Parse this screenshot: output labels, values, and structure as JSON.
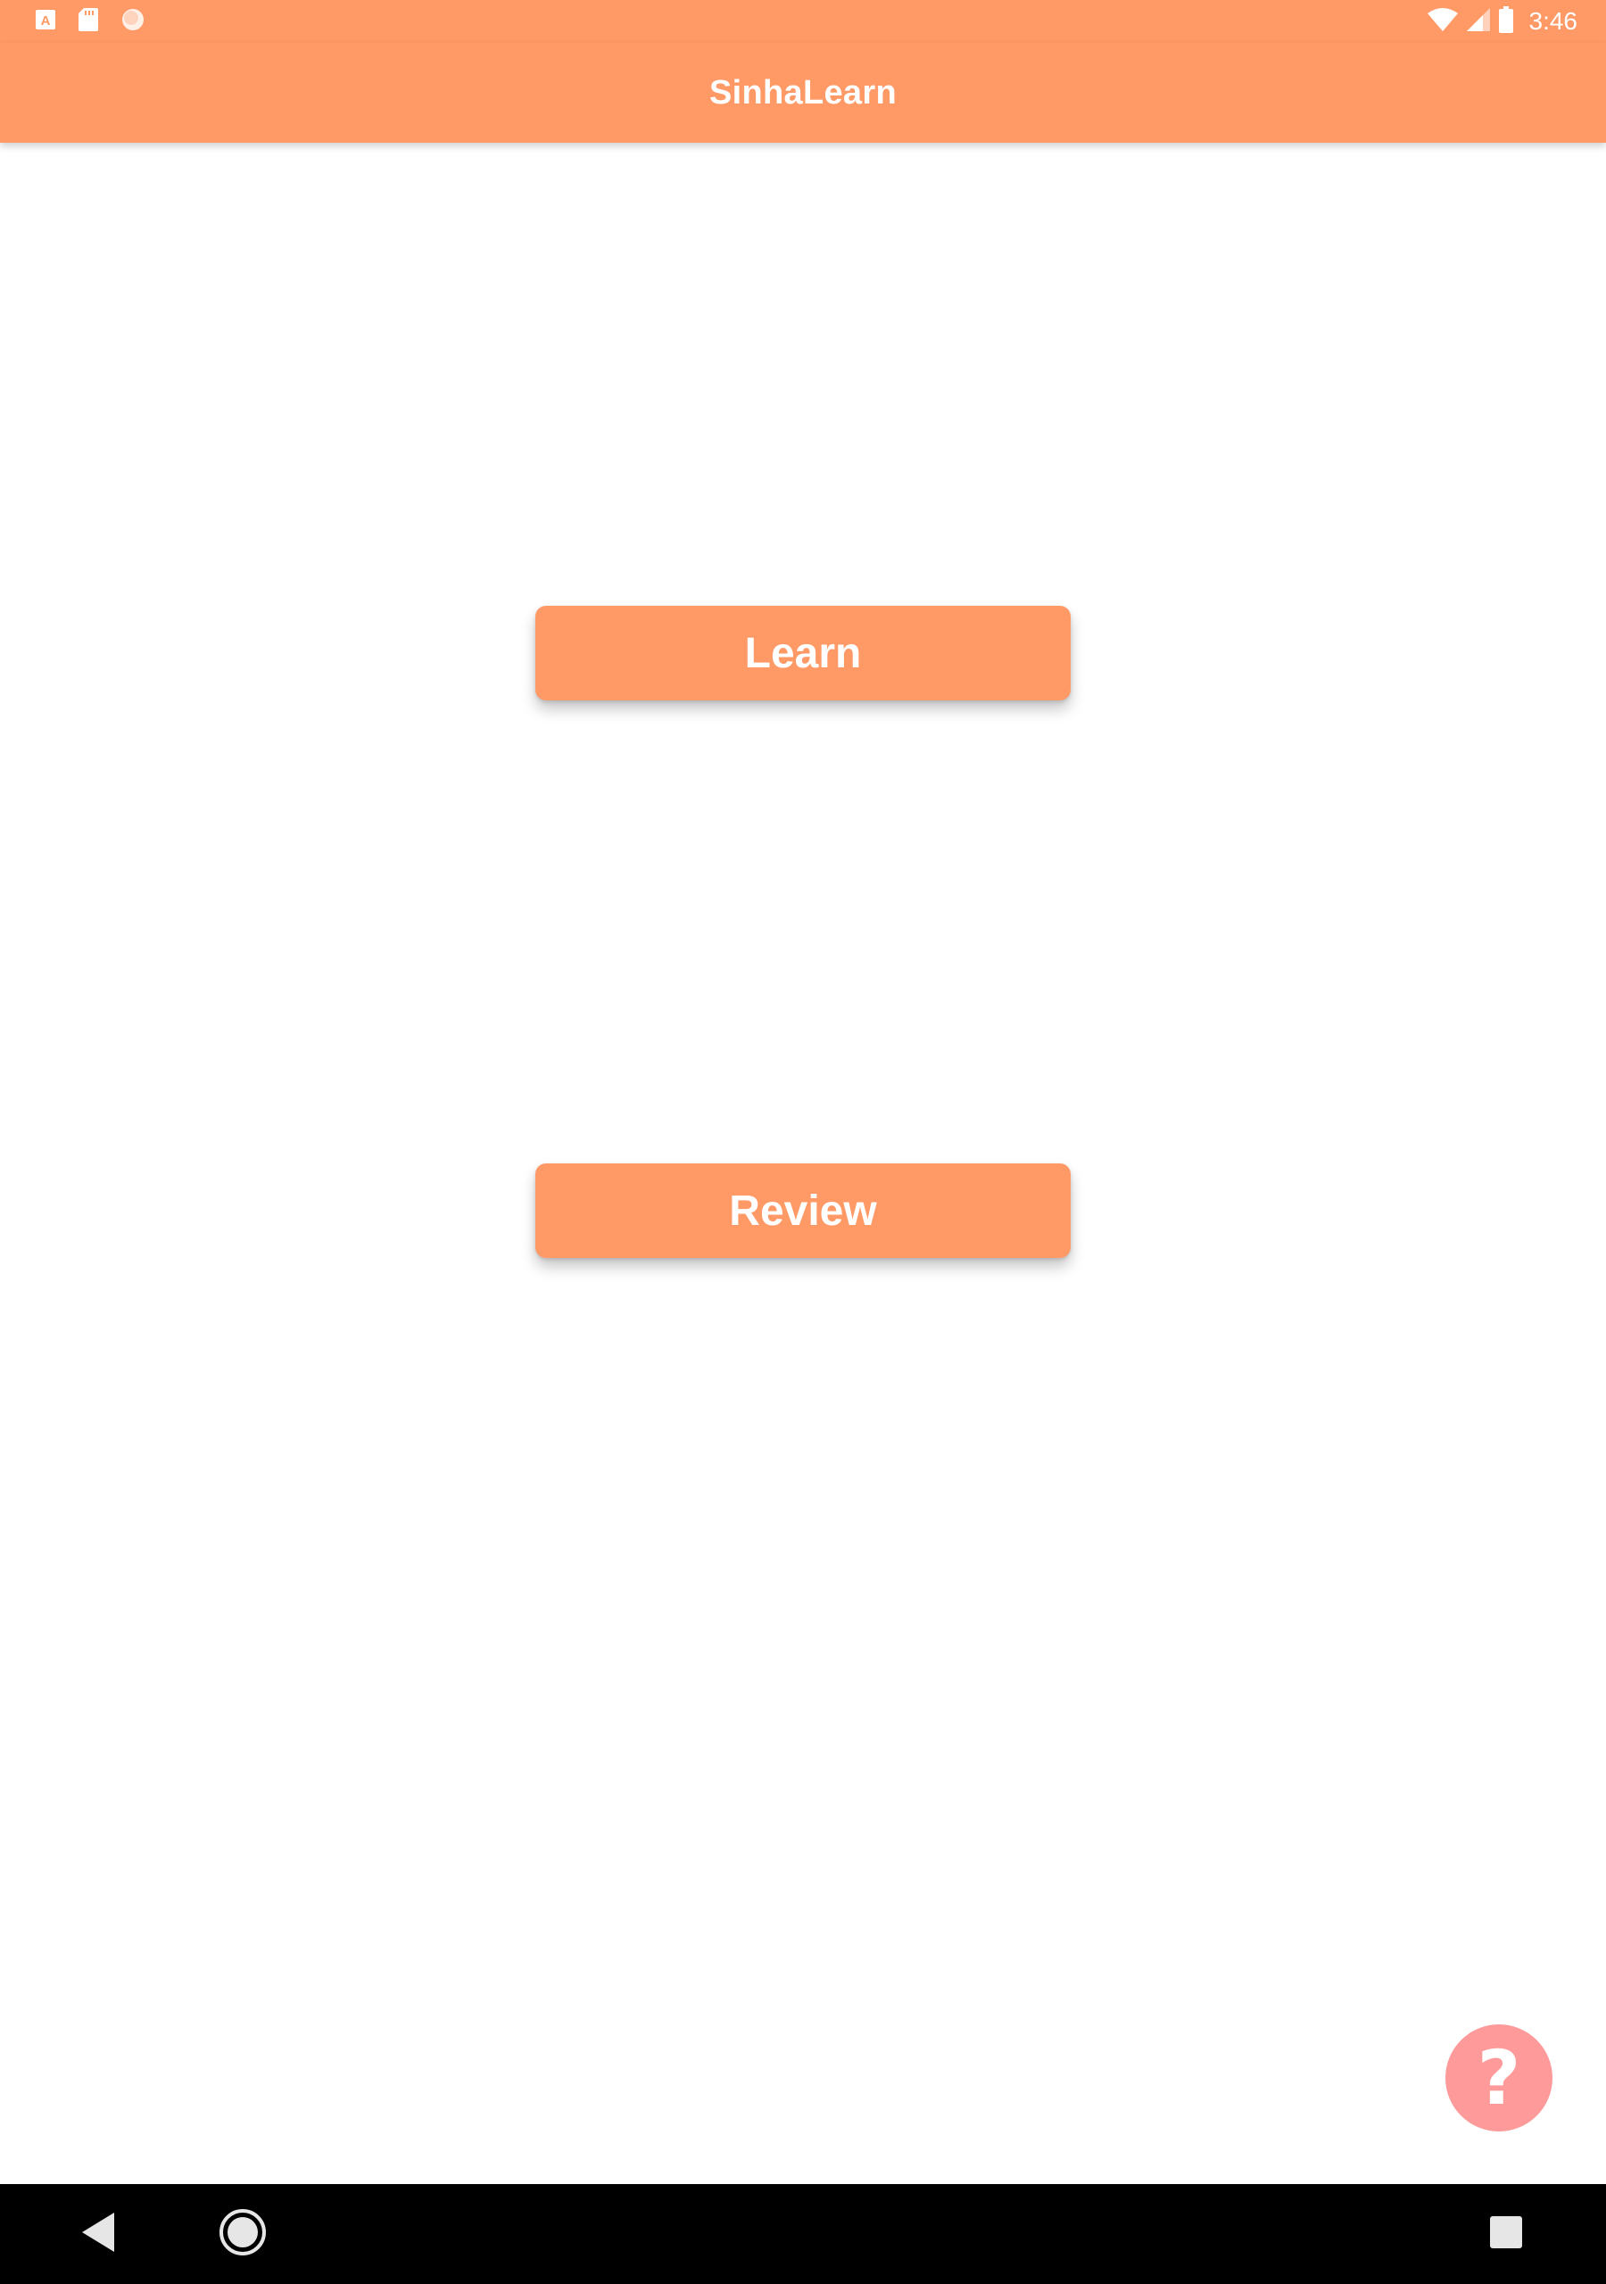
{
  "status_bar": {
    "time": "3:46",
    "left_icons": [
      "a-notification-icon",
      "sd-card-icon",
      "circle-notification-icon"
    ],
    "right_icons": [
      "wifi-icon",
      "cell-signal-icon",
      "battery-icon"
    ]
  },
  "app_bar": {
    "title": "SinhaLearn"
  },
  "main": {
    "learn_label": "Learn",
    "review_label": "Review"
  },
  "fab": {
    "label": "?",
    "icon": "help-icon"
  },
  "nav_bar": {
    "icons": [
      "back-icon",
      "home-icon",
      "recents-icon"
    ]
  },
  "colors": {
    "primary": "#ff9966",
    "fab": "#ff9a9a",
    "nav_bar": "#000000",
    "background": "#ffffff"
  }
}
